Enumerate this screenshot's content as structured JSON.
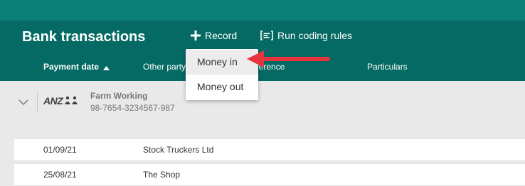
{
  "header": {
    "title": "Bank transactions",
    "record_label": "Record",
    "record_icon": "plus-icon",
    "coding_rules_label": "Run coding rules",
    "coding_rules_icon": "coding-rules-icon",
    "colors": {
      "topbar": "#0a8078",
      "header": "#046a63"
    }
  },
  "columns": {
    "payment_date": "Payment date",
    "sort_direction": "ascending",
    "other_party": "Other party",
    "reference": "Reference",
    "particulars": "Particulars"
  },
  "record_menu": {
    "items": [
      {
        "label": "Money in",
        "highlighted": true
      },
      {
        "label": "Money out",
        "highlighted": false
      }
    ]
  },
  "account": {
    "bank_logo": "ANZ",
    "name": "Farm Working",
    "number": "98-7654-3234567-987"
  },
  "transactions": [
    {
      "date": "01/09/21",
      "party": "Stock Truckers Ltd"
    },
    {
      "date": "25/08/21",
      "party": "The Shop"
    }
  ],
  "annotation": {
    "arrow_color": "#e8343c"
  }
}
